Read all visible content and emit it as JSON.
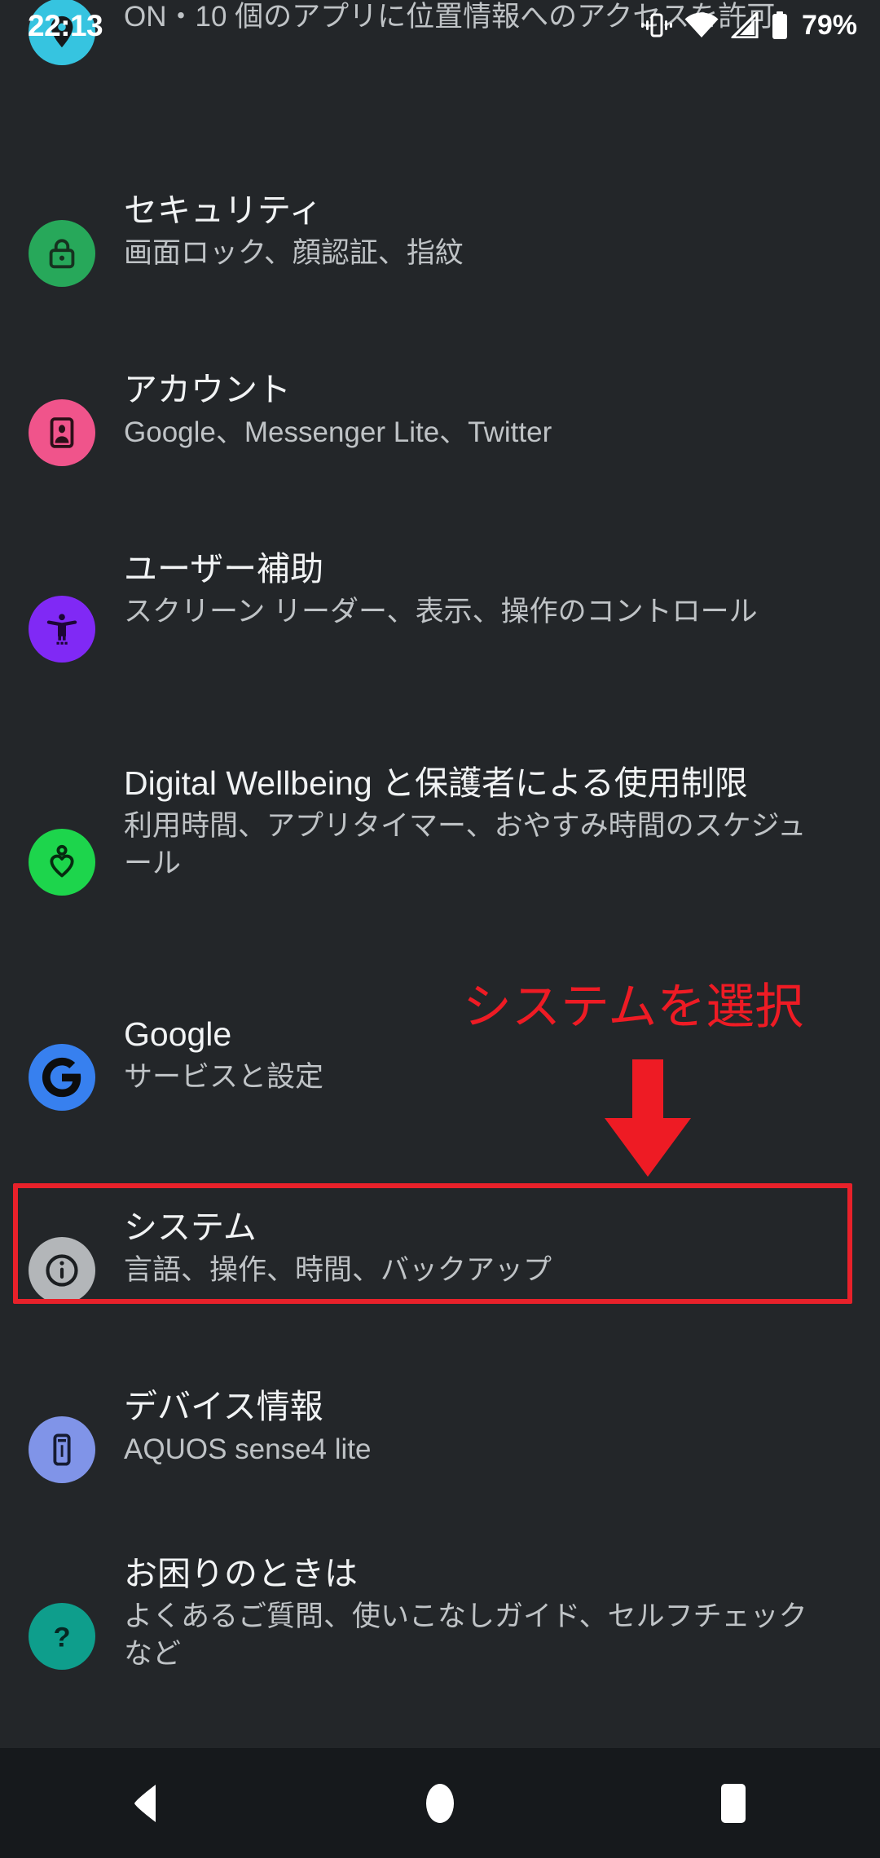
{
  "status_bar": {
    "clock": "22:13",
    "battery_percent": "79%",
    "icons": [
      "vibrate-icon",
      "wifi-icon",
      "cellular-signal-icon",
      "battery-icon"
    ]
  },
  "settings": {
    "items": [
      {
        "id": "location",
        "title": "",
        "subtitle": "ON・10 個のアプリに位置情報へのアクセスを許可",
        "icon": "location-pin-icon",
        "icon_bg": "#36C4E0",
        "clipped": true
      },
      {
        "id": "security",
        "title": "セキュリティ",
        "subtitle": "画面ロック、顔認証、指紋",
        "icon": "lock-icon",
        "icon_bg": "#27A85A"
      },
      {
        "id": "accounts",
        "title": "アカウント",
        "subtitle": "Google、Messenger Lite、Twitter",
        "icon": "account-card-icon",
        "icon_bg": "#F0548B"
      },
      {
        "id": "accessibility",
        "title": "ユーザー補助",
        "subtitle": "スクリーン リーダー、表示、操作のコントロール",
        "icon": "accessibility-icon",
        "icon_bg": "#8029F5"
      },
      {
        "id": "digital-wellbeing",
        "title": "Digital Wellbeing と保護者による使用制限",
        "subtitle": "利用時間、アプリタイマー、おやすみ時間のスケジュール",
        "icon": "heart-person-icon",
        "icon_bg": "#1DD54C"
      },
      {
        "id": "google",
        "title": "Google",
        "subtitle": "サービスと設定",
        "icon": "google-g-icon",
        "icon_bg": "#3780EF"
      },
      {
        "id": "system",
        "title": "システム",
        "subtitle": "言語、操作、時間、バックアップ",
        "icon": "info-circle-icon",
        "icon_bg": "#B3B6B9",
        "highlighted": true
      },
      {
        "id": "device-info",
        "title": "デバイス情報",
        "subtitle": "AQUOS sense4 lite",
        "icon": "phone-device-icon",
        "icon_bg": "#8094E8"
      },
      {
        "id": "help",
        "title": "お困りのときは",
        "subtitle": "よくあるご質問、使いこなしガイド、セルフチェックなど",
        "icon": "question-mark-icon",
        "icon_bg": "#0E9E8C"
      }
    ]
  },
  "annotation": {
    "text": "システムを選択",
    "color": "#EE1B24",
    "arrow": "down-arrow-icon",
    "highlight_target": "system"
  },
  "nav_bar": {
    "back_label": "back-button",
    "home_label": "home-button",
    "recents_label": "recents-button"
  },
  "colors": {
    "background": "#232629",
    "nav_background": "#16191C",
    "title_text": "#F1F3F4",
    "subtitle_text": "#BFC3C6",
    "annotation_red": "#EE1B24"
  }
}
